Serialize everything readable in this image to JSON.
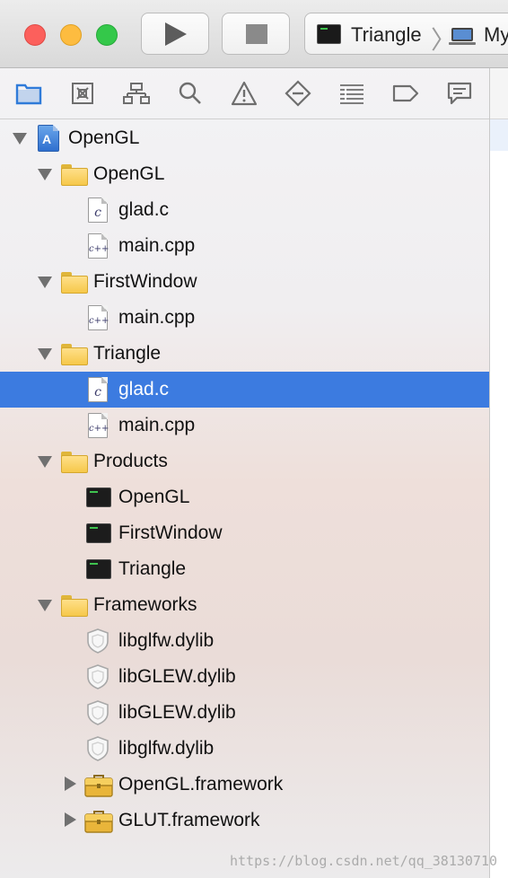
{
  "toolbar": {
    "scheme_name": "Triangle",
    "scheme_separator": "〉",
    "destination_name": "My"
  },
  "navigator_tabs": [
    "project-navigator",
    "source-control-navigator",
    "symbol-navigator",
    "find-navigator",
    "issue-navigator",
    "test-navigator",
    "debug-navigator",
    "breakpoint-navigator",
    "report-navigator"
  ],
  "tree": [
    {
      "label": "OpenGL",
      "type": "project",
      "depth": 0,
      "disclosure": "open",
      "selected": false
    },
    {
      "label": "OpenGL",
      "type": "folder",
      "depth": 1,
      "disclosure": "open",
      "selected": false
    },
    {
      "label": "glad.c",
      "type": "c-file",
      "file_letter": "c",
      "depth": 2,
      "disclosure": "none",
      "selected": false
    },
    {
      "label": "main.cpp",
      "type": "cpp-file",
      "file_letter": "c++",
      "depth": 2,
      "disclosure": "none",
      "selected": false
    },
    {
      "label": "FirstWindow",
      "type": "folder",
      "depth": 1,
      "disclosure": "open",
      "selected": false
    },
    {
      "label": "main.cpp",
      "type": "cpp-file",
      "file_letter": "c++",
      "depth": 2,
      "disclosure": "none",
      "selected": false
    },
    {
      "label": "Triangle",
      "type": "folder",
      "depth": 1,
      "disclosure": "open",
      "selected": false
    },
    {
      "label": "glad.c",
      "type": "c-file",
      "file_letter": "c",
      "depth": 2,
      "disclosure": "none",
      "selected": true
    },
    {
      "label": "main.cpp",
      "type": "cpp-file",
      "file_letter": "c++",
      "depth": 2,
      "disclosure": "none",
      "selected": false
    },
    {
      "label": "Products",
      "type": "folder",
      "depth": 1,
      "disclosure": "open",
      "selected": false
    },
    {
      "label": "OpenGL",
      "type": "executable",
      "depth": 2,
      "disclosure": "none",
      "selected": false
    },
    {
      "label": "FirstWindow",
      "type": "executable",
      "depth": 2,
      "disclosure": "none",
      "selected": false
    },
    {
      "label": "Triangle",
      "type": "executable",
      "depth": 2,
      "disclosure": "none",
      "selected": false
    },
    {
      "label": "Frameworks",
      "type": "folder",
      "depth": 1,
      "disclosure": "open",
      "selected": false
    },
    {
      "label": "libglfw.dylib",
      "type": "library",
      "depth": 2,
      "disclosure": "none",
      "selected": false
    },
    {
      "label": "libGLEW.dylib",
      "type": "library",
      "depth": 2,
      "disclosure": "none",
      "selected": false
    },
    {
      "label": "libGLEW.dylib",
      "type": "library",
      "depth": 2,
      "disclosure": "none",
      "selected": false
    },
    {
      "label": "libglfw.dylib",
      "type": "library",
      "depth": 2,
      "disclosure": "none",
      "selected": false
    },
    {
      "label": "OpenGL.framework",
      "type": "framework",
      "depth": 2,
      "disclosure": "closed",
      "selected": false
    },
    {
      "label": "GLUT.framework",
      "type": "framework",
      "depth": 2,
      "disclosure": "closed",
      "selected": false
    }
  ],
  "colors": {
    "selection": "#3c7be0",
    "nav_active": "#2f7bd9",
    "icon_gray": "#6e6e6e"
  },
  "watermark": "https://blog.csdn.net/qq_38130710"
}
